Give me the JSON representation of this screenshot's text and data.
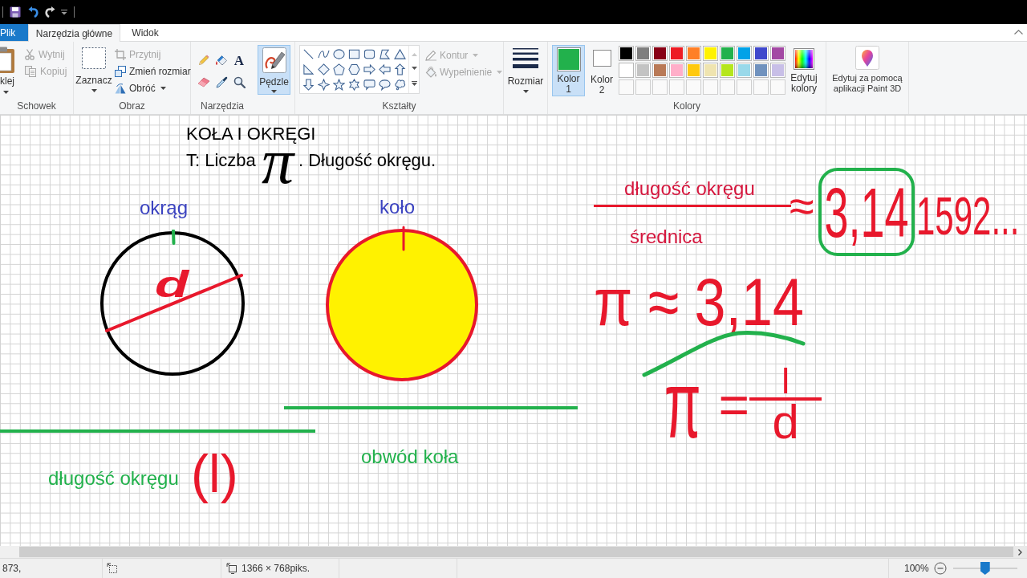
{
  "tabs": [
    {
      "label": "Plik",
      "kind": "file",
      "selected": false
    },
    {
      "label": "Narzędzia główne",
      "kind": "tab",
      "selected": true
    },
    {
      "label": "Widok",
      "kind": "tab",
      "selected": false
    }
  ],
  "ribbon": {
    "clipboard": {
      "label": "Schowek",
      "paste": "klej",
      "items": [
        {
          "label": "Wytnij",
          "disabled": true
        },
        {
          "label": "Kopiuj",
          "disabled": true
        }
      ]
    },
    "image": {
      "label": "Obraz",
      "select": "Zaznacz",
      "items": [
        {
          "label": "Przytnij",
          "disabled": true,
          "dropdown": false
        },
        {
          "label": "Zmień rozmiar",
          "disabled": false,
          "dropdown": false
        },
        {
          "label": "Obróć",
          "disabled": false,
          "dropdown": true
        }
      ]
    },
    "tools": {
      "label": "Narzędzia",
      "text_tool": "A"
    },
    "brushes": {
      "label": "Pędzle",
      "selected": true
    },
    "shapes": {
      "label": "Kształty",
      "items": [
        {
          "label": "Kontur",
          "disabled": true,
          "dropdown": true
        },
        {
          "label": "Wypełnienie",
          "disabled": true,
          "dropdown": true
        }
      ]
    },
    "size": {
      "label": "Rozmiar"
    },
    "colors": {
      "label": "Kolory",
      "slots": [
        {
          "label": "Kolor 1",
          "color": "#22b14c",
          "selected": true
        },
        {
          "label": "Kolor 2",
          "color": "#ffffff",
          "selected": false
        }
      ],
      "palette": [
        {
          "kind": "swatch",
          "color": "#000000"
        },
        {
          "kind": "swatch",
          "color": "#7f7f7f"
        },
        {
          "kind": "swatch",
          "color": "#880015"
        },
        {
          "kind": "swatch",
          "color": "#ed1c24"
        },
        {
          "kind": "swatch",
          "color": "#ff7f27"
        },
        {
          "kind": "swatch",
          "color": "#fff200"
        },
        {
          "kind": "swatch",
          "color": "#22b14c"
        },
        {
          "kind": "swatch",
          "color": "#00a2e8"
        },
        {
          "kind": "swatch",
          "color": "#3f48cc"
        },
        {
          "kind": "swatch",
          "color": "#a349a4"
        },
        {
          "kind": "swatch",
          "color": "#ffffff"
        },
        {
          "kind": "swatch",
          "color": "#c3c3c3"
        },
        {
          "kind": "swatch",
          "color": "#b97a57"
        },
        {
          "kind": "swatch",
          "color": "#ffaec9"
        },
        {
          "kind": "swatch",
          "color": "#ffc90e"
        },
        {
          "kind": "swatch",
          "color": "#efe4b0"
        },
        {
          "kind": "swatch",
          "color": "#b5e61d"
        },
        {
          "kind": "swatch",
          "color": "#99d9ea"
        },
        {
          "kind": "swatch",
          "color": "#7092be"
        },
        {
          "kind": "swatch",
          "color": "#c8bfe7"
        },
        {
          "kind": "empty"
        },
        {
          "kind": "empty"
        },
        {
          "kind": "empty"
        },
        {
          "kind": "empty"
        },
        {
          "kind": "empty"
        },
        {
          "kind": "empty"
        },
        {
          "kind": "empty"
        },
        {
          "kind": "empty"
        },
        {
          "kind": "empty"
        },
        {
          "kind": "empty"
        }
      ],
      "edit": "Edytuj kolory"
    },
    "paint3d": "Edytuj za pomocą aplikacji Paint 3D"
  },
  "canvas": {
    "title": "KOŁA I OKRĘGI",
    "topic": {
      "prefix": "T: Liczba",
      "symbol": "π",
      "suffix": ". Długość okręgu."
    },
    "figures": [
      {
        "kind": "circle",
        "label": "okrąg",
        "mark": "d"
      },
      {
        "kind": "disc",
        "label": "koło"
      }
    ],
    "notes": [
      {
        "text": "długość okręgu",
        "mark": "(l)"
      },
      {
        "text": "obwód koła"
      }
    ],
    "ratio": {
      "numerator": "długość okręgu",
      "denominator": "średnica",
      "sign": "≈",
      "circled": "3,14",
      "rest": "1592..."
    },
    "approximation": "π ≈ 3,14",
    "formula": {
      "symbol": "π",
      "sign": "=",
      "numerator": "l",
      "denominator": "d"
    }
  },
  "status_bar": {
    "cursor": "873,",
    "canvas_size": "1366 × 768piks.",
    "zoom": {
      "reading": "100%",
      "level": 0.5
    }
  }
}
